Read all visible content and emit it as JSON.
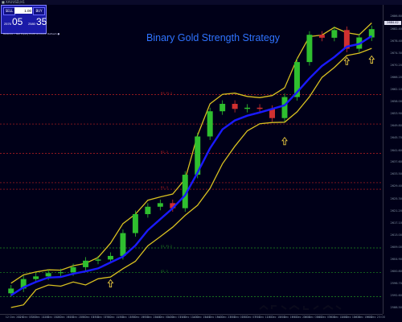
{
  "window": {
    "title": "■ XAUUSD,H1"
  },
  "chart_title": "Binary Gold Strength Strategy",
  "trade_panel": {
    "sell_label": "SELL",
    "buy_label": "BUY",
    "lot_value": "1.00",
    "bid_small": "2576",
    "bid_big": "05",
    "ask_small": "2580",
    "ask_big": "35",
    "info": "Balance • Net Equity Profit Account: Refresh ●"
  },
  "price_axis": {
    "labels": [
      "2686.80",
      "2682.40",
      "2678.40",
      "2674.30",
      "2670.20",
      "2666.20",
      "2662.10",
      "2658.00",
      "2653.90",
      "2649.80",
      "2645.70",
      "2641.60",
      "2637.60",
      "2633.50",
      "2629.40",
      "2625.30",
      "2621.20",
      "2617.10",
      "2613.00",
      "2609.00",
      "2604.90",
      "2600.80",
      "2596.70",
      "2592.60",
      "2588.50"
    ],
    "last_price": "2684.42"
  },
  "time_axis": {
    "labels": [
      "12 Dec 2020",
      "12 Dec 07:00",
      "12 Dec 11:00",
      "12 Dec 15:00",
      "12 Dec 19:00",
      "12 Dec 23:00",
      "13 Dec 03:00",
      "13 Dec 07:00",
      "13 Dec 11:00",
      "13 Dec 15:00",
      "13 Dec 19:00",
      "13 Dec 23:00",
      "14 Dec 03:00",
      "14 Dec 07:00",
      "14 Dec 11:00",
      "14 Dec 15:00",
      "14 Dec 19:00",
      "14 Dec 23:00",
      "15 Dec 03:00",
      "15 Dec 07:00",
      "15 Dec 11:00",
      "15 Dec 15:00",
      "15 Dec 19:00",
      "15 Dec 23:00",
      "16 Dec 03:00",
      "16 Dec 07:00",
      "16 Dec 11:00",
      "16 Dec 15:00",
      "16 Dec 19:00",
      "16 Dec 23:00"
    ]
  },
  "levels": [
    {
      "label": "R3, FL 2",
      "price": 2660.3,
      "color": "#c02020"
    },
    {
      "label": "R2, 2",
      "price": 2640.5,
      "color": "#c02020"
    },
    {
      "label": "R1, 2",
      "price": 2628.4,
      "color": "#c02020"
    },
    {
      "label": "",
      "price": 2650.4,
      "color": "#c02020"
    },
    {
      "label": "",
      "price": 2630.6,
      "color": "#c02020"
    },
    {
      "label": "S1, FL 2",
      "price": 2608.6,
      "color": "#1f8f1f"
    },
    {
      "label": "S2, 2",
      "price": 2600.3,
      "color": "#1f8f1f"
    },
    {
      "label": "",
      "price": 2592.2,
      "color": "#1f8f1f"
    }
  ],
  "colors": {
    "background": "#000018",
    "bull": "#2fbf2f",
    "bear": "#d03030",
    "ma": "#1a1aff",
    "bands": "#d8c020",
    "arrow": "#e8c840"
  },
  "chart_data": {
    "type": "candlestick",
    "x": [
      "12 Dec 2020",
      "12 Dec 07:00",
      "12 Dec 11:00",
      "12 Dec 15:00",
      "12 Dec 19:00",
      "12 Dec 23:00",
      "13 Dec 03:00",
      "13 Dec 07:00",
      "13 Dec 11:00",
      "13 Dec 15:00",
      "13 Dec 19:00",
      "13 Dec 23:00",
      "14 Dec 03:00",
      "14 Dec 07:00",
      "14 Dec 11:00",
      "14 Dec 15:00",
      "14 Dec 19:00",
      "14 Dec 23:00",
      "15 Dec 03:00",
      "15 Dec 07:00",
      "15 Dec 11:00",
      "15 Dec 15:00",
      "15 Dec 19:00",
      "15 Dec 23:00",
      "16 Dec 03:00",
      "16 Dec 07:00",
      "16 Dec 11:00",
      "16 Dec 15:00",
      "16 Dec 19:00",
      "16 Dec 23:00"
    ],
    "close": [
      2594.9,
      2598.1,
      2599.0,
      2600.1,
      2600.4,
      2602.1,
      2604.3,
      2604.7,
      2605.9,
      2613.6,
      2620.0,
      2622.5,
      2623.7,
      2622.0,
      2633.3,
      2646.2,
      2654.7,
      2657.2,
      2655.5,
      2655.9,
      2655.5,
      2652.4,
      2659.5,
      2671.3,
      2680.5,
      2679.5,
      2682.1,
      2675.8,
      2679.6,
      2682.4
    ],
    "ma": [
      2592.6,
      2595.3,
      2597.1,
      2598.6,
      2598.8,
      2599.9,
      2600.7,
      2601.7,
      2603.7,
      2605.7,
      2609.4,
      2614.6,
      2618.3,
      2622.0,
      2626.4,
      2634.0,
      2642.2,
      2648.6,
      2651.6,
      2653.2,
      2654.3,
      2655.5,
      2656.7,
      2661.1,
      2665.8,
      2670.0,
      2673.0,
      2676.5,
      2677.4,
      2680.1
    ],
    "band_upper": [
      2596.7,
      2599.5,
      2600.5,
      2601.2,
      2601.1,
      2602.6,
      2603.4,
      2605.4,
      2610.2,
      2616.8,
      2620.0,
      2624.7,
      2625.8,
      2626.8,
      2631.8,
      2646.6,
      2657.2,
      2660.4,
      2660.8,
      2659.7,
      2659.3,
      2660.0,
      2662.6,
      2672.4,
      2679.9,
      2680.4,
      2683.0,
      2681.2,
      2680.5,
      2684.5
    ],
    "band_lower": [
      2588.5,
      2589.4,
      2594.5,
      2596.1,
      2595.7,
      2597.1,
      2596.1,
      2598.2,
      2598.8,
      2601.6,
      2604.1,
      2609.3,
      2612.4,
      2615.6,
      2619.6,
      2623.0,
      2628.7,
      2637.0,
      2642.9,
      2648.1,
      2650.5,
      2650.9,
      2651.0,
      2654.5,
      2659.6,
      2666.1,
      2669.5,
      2673.5,
      2674.3,
      2675.9
    ],
    "arrows": [
      {
        "x": "13 Dec 11:00",
        "price": 2596.5
      },
      {
        "x": "15 Dec 19:00",
        "price": 2644.5
      },
      {
        "x": "16 Dec 15:00",
        "price": 2671.5
      },
      {
        "x": "16 Dec 23:00",
        "price": 2672.0
      }
    ],
    "ylim": [
      2588.5,
      2686.8
    ],
    "grid": false
  }
}
